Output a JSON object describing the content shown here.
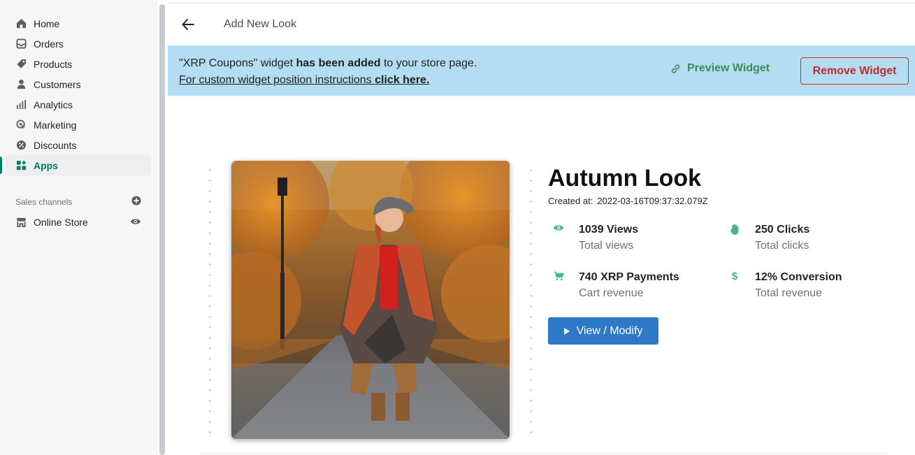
{
  "sidebar": {
    "items": [
      {
        "label": "Home",
        "icon": "home-icon"
      },
      {
        "label": "Orders",
        "icon": "inbox-icon"
      },
      {
        "label": "Products",
        "icon": "tag-icon"
      },
      {
        "label": "Customers",
        "icon": "person-icon"
      },
      {
        "label": "Analytics",
        "icon": "bar-chart-icon"
      },
      {
        "label": "Marketing",
        "icon": "target-icon"
      },
      {
        "label": "Discounts",
        "icon": "discount-icon"
      },
      {
        "label": "Apps",
        "icon": "apps-icon",
        "active": true
      }
    ],
    "channels_heading": "Sales channels",
    "online_store": "Online Store",
    "active_color": "#007f5f"
  },
  "header": {
    "title": "Add New Look"
  },
  "banner": {
    "prefix": "\"XRP Coupons\" widget ",
    "bold": "has been added",
    "suffix": " to your store page.",
    "link_text": "For custom widget position instructions ",
    "link_bold": "click here.",
    "preview_label": "Preview Widget",
    "remove_label": "Remove Widget",
    "background": "#b4dcf3"
  },
  "look": {
    "title": "Autumn Look",
    "created_label": "Created at:",
    "created_value": "2022-03-16T09:37:32.079Z",
    "stats": [
      {
        "value": "1039 Views",
        "label": "Total views",
        "icon": "eye-icon"
      },
      {
        "value": "250 Clicks",
        "label": "Total clicks",
        "icon": "hand-icon"
      },
      {
        "value": "740 XRP Payments",
        "label": "Cart revenue",
        "icon": "cart-icon"
      },
      {
        "value": "12% Conversion",
        "label": "Total revenue",
        "icon": "dollar-icon"
      }
    ],
    "view_label": "View / Modify",
    "accent_color": "#2e78c8",
    "stat_icon_color": "#47b881"
  }
}
